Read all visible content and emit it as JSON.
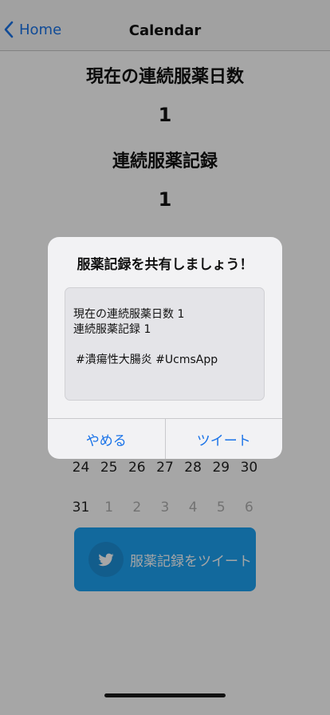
{
  "nav": {
    "back_label": "Home",
    "title": "Calendar"
  },
  "stats": {
    "current_streak_label": "現在の連続服薬日数",
    "current_streak_value": "1",
    "record_label": "連続服薬記録",
    "record_value": "1"
  },
  "calendar": {
    "row_last_full": [
      "24",
      "25",
      "26",
      "27",
      "28",
      "29",
      "30"
    ],
    "row_final": [
      "31",
      "1",
      "2",
      "3",
      "4",
      "5",
      "6"
    ]
  },
  "tweet_button": {
    "label": "服薬記録をツイート",
    "icon": "twitter-bird-icon",
    "color": "#1da1f2"
  },
  "dialog": {
    "title": "服薬記録を共有しましょう！",
    "message_line1": "現在の連続服薬日数 1",
    "message_line2": "連続服薬記録 1",
    "message_tags": "#潰瘍性大腸炎 #UcmsApp",
    "cancel_label": "やめる",
    "tweet_label": "ツイート"
  },
  "colors": {
    "accent": "#1a73e8",
    "twitter": "#1da1f2"
  }
}
